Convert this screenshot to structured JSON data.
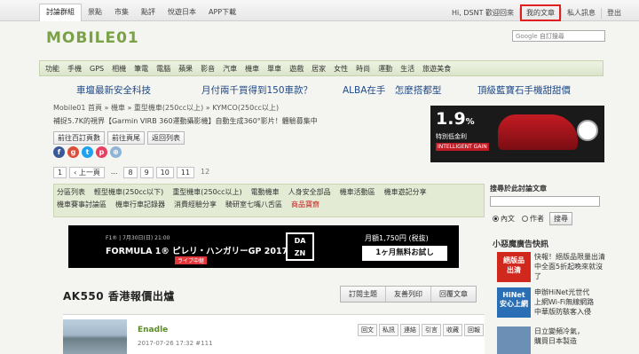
{
  "topbar": {
    "nav": [
      "討論群組",
      "景點",
      "市集",
      "點評",
      "悅遊日本",
      "APP下載"
    ],
    "greeting": "Hi, DSNT 歡迎回來",
    "my_articles": "我的文章",
    "private_messages": "私人訊息",
    "logout": "登出"
  },
  "header": {
    "logo": "MOBILE01",
    "search_brand": "Google",
    "search_placeholder": "自訂搜尋"
  },
  "categories": [
    "功能",
    "手機",
    "GPS",
    "相機",
    "筆電",
    "電腦",
    "蘋果",
    "影音",
    "汽車",
    "機車",
    "單車",
    "遊戲",
    "居家",
    "女性",
    "時尚",
    "運動",
    "生活",
    "旅遊美食"
  ],
  "promos": [
    "車壇最新安全科技",
    "月付兩千買得到150車款？",
    "ALBA在手　怎麼搭都型",
    "頂級藍寶石手機甜甜價"
  ],
  "breadcrumb": "Mobile01 首頁 » 機車 » 重型機車(250cc以上) » KYMCO(250cc以上)",
  "thread_subtitle": "補捉5.7K的視界【Garmin VIRB 360運動攝影機】自動生成360°影片！體驗募集中",
  "thread_buttons": [
    "前往百訂頁數",
    "前往頁尾",
    "返回列表"
  ],
  "social": [
    {
      "label": "f",
      "color": "#3b5998",
      "icon": "facebook-icon"
    },
    {
      "label": "g",
      "color": "#dd4b39",
      "icon": "google-plus-icon"
    },
    {
      "label": "t",
      "color": "#1da1f2",
      "icon": "twitter-icon"
    },
    {
      "label": "p",
      "color": "#e4405f",
      "icon": "weibo-icon"
    },
    {
      "label": "⊕",
      "color": "#8eb4d6",
      "icon": "share-icon"
    }
  ],
  "pager": {
    "first": "1",
    "prev": "‹ 上一頁",
    "dots": "...",
    "pages": [
      "8",
      "9",
      "10",
      "11"
    ],
    "current": "12"
  },
  "side_ad": {
    "percent": "1.9",
    "percent_unit": "%",
    "line2": "特別低金利",
    "line3": "INTELLIGENT GAIN"
  },
  "forum_tabs": {
    "row1": [
      "分區列表",
      "輕型機車(250cc以下)",
      "重型機車(250cc以上)",
      "電動機車",
      "人身安全部品",
      "機車活動區",
      "機車遊記分享"
    ],
    "row2": [
      "機車賽事討論區",
      "機車行車記錄器",
      "消費經驗分享",
      "騎研室七嘴八舌區"
    ],
    "row2_special": "商品寶齋"
  },
  "banner": {
    "line1": "F1® | 7月30日(日) 21:00",
    "line2": "FORMULA 1® ピレリ・ハンガリーGP 2017",
    "line3": "ライブ中継",
    "brand": "DA ZN",
    "price": "月額1,750円 (税抜)",
    "cta": "1ヶ月無料お試し"
  },
  "thread": {
    "title": "AK550 香港報價出爐",
    "actions": [
      "訂閱主題",
      "友善列印",
      "回覆文章"
    ]
  },
  "post": {
    "author": "Enadle",
    "time": "2017-07-26 17:32 #111",
    "tools": [
      "回文",
      "私訊",
      "連結",
      "引言",
      "收藏",
      "回報"
    ]
  },
  "sidebar": {
    "search_title": "搜尋於此討論文章",
    "radio_content": "內文",
    "radio_author": "作者",
    "search_button": "搜尋",
    "ad_title": "小惡魔廣告快訊",
    "ads": [
      {
        "thumb": "絕版品\n出清",
        "thumb_color": "#d0281d",
        "text": "快報！絕版品限量出清中全面5折起晚來就沒了"
      },
      {
        "thumb": "HiNet\n安心上網",
        "thumb_color": "#2a6fb5",
        "text": "申辦HiNet光世代\n上網Wi-Fi無線網路\n中華版防駭客入侵"
      },
      {
        "thumb": "",
        "thumb_color": "#6b8fb5",
        "text": "日立變頻冷氣，\n購買日本製造"
      }
    ]
  }
}
